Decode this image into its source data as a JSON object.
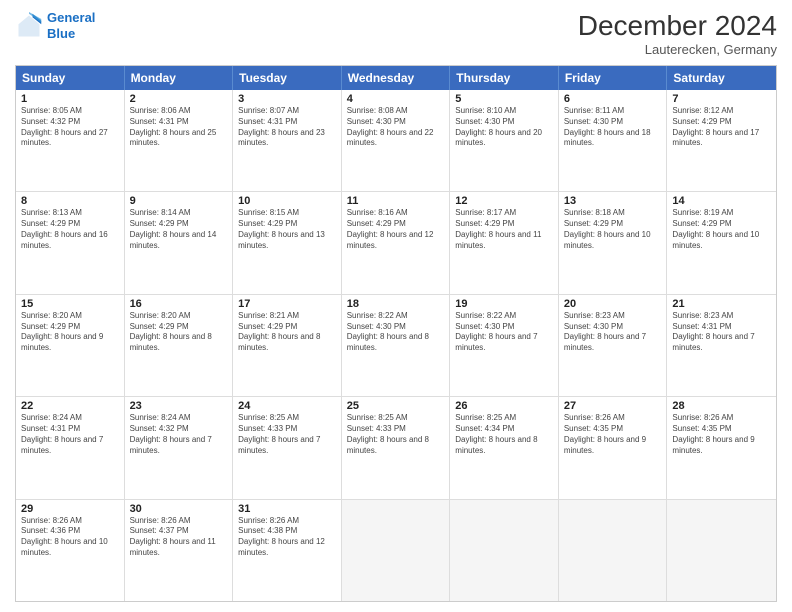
{
  "logo": {
    "line1": "General",
    "line2": "Blue"
  },
  "header": {
    "month_year": "December 2024",
    "location": "Lauterecken, Germany"
  },
  "weekdays": [
    "Sunday",
    "Monday",
    "Tuesday",
    "Wednesday",
    "Thursday",
    "Friday",
    "Saturday"
  ],
  "rows": [
    [
      {
        "day": "1",
        "sunrise": "Sunrise: 8:05 AM",
        "sunset": "Sunset: 4:32 PM",
        "daylight": "Daylight: 8 hours and 27 minutes."
      },
      {
        "day": "2",
        "sunrise": "Sunrise: 8:06 AM",
        "sunset": "Sunset: 4:31 PM",
        "daylight": "Daylight: 8 hours and 25 minutes."
      },
      {
        "day": "3",
        "sunrise": "Sunrise: 8:07 AM",
        "sunset": "Sunset: 4:31 PM",
        "daylight": "Daylight: 8 hours and 23 minutes."
      },
      {
        "day": "4",
        "sunrise": "Sunrise: 8:08 AM",
        "sunset": "Sunset: 4:30 PM",
        "daylight": "Daylight: 8 hours and 22 minutes."
      },
      {
        "day": "5",
        "sunrise": "Sunrise: 8:10 AM",
        "sunset": "Sunset: 4:30 PM",
        "daylight": "Daylight: 8 hours and 20 minutes."
      },
      {
        "day": "6",
        "sunrise": "Sunrise: 8:11 AM",
        "sunset": "Sunset: 4:30 PM",
        "daylight": "Daylight: 8 hours and 18 minutes."
      },
      {
        "day": "7",
        "sunrise": "Sunrise: 8:12 AM",
        "sunset": "Sunset: 4:29 PM",
        "daylight": "Daylight: 8 hours and 17 minutes."
      }
    ],
    [
      {
        "day": "8",
        "sunrise": "Sunrise: 8:13 AM",
        "sunset": "Sunset: 4:29 PM",
        "daylight": "Daylight: 8 hours and 16 minutes."
      },
      {
        "day": "9",
        "sunrise": "Sunrise: 8:14 AM",
        "sunset": "Sunset: 4:29 PM",
        "daylight": "Daylight: 8 hours and 14 minutes."
      },
      {
        "day": "10",
        "sunrise": "Sunrise: 8:15 AM",
        "sunset": "Sunset: 4:29 PM",
        "daylight": "Daylight: 8 hours and 13 minutes."
      },
      {
        "day": "11",
        "sunrise": "Sunrise: 8:16 AM",
        "sunset": "Sunset: 4:29 PM",
        "daylight": "Daylight: 8 hours and 12 minutes."
      },
      {
        "day": "12",
        "sunrise": "Sunrise: 8:17 AM",
        "sunset": "Sunset: 4:29 PM",
        "daylight": "Daylight: 8 hours and 11 minutes."
      },
      {
        "day": "13",
        "sunrise": "Sunrise: 8:18 AM",
        "sunset": "Sunset: 4:29 PM",
        "daylight": "Daylight: 8 hours and 10 minutes."
      },
      {
        "day": "14",
        "sunrise": "Sunrise: 8:19 AM",
        "sunset": "Sunset: 4:29 PM",
        "daylight": "Daylight: 8 hours and 10 minutes."
      }
    ],
    [
      {
        "day": "15",
        "sunrise": "Sunrise: 8:20 AM",
        "sunset": "Sunset: 4:29 PM",
        "daylight": "Daylight: 8 hours and 9 minutes."
      },
      {
        "day": "16",
        "sunrise": "Sunrise: 8:20 AM",
        "sunset": "Sunset: 4:29 PM",
        "daylight": "Daylight: 8 hours and 8 minutes."
      },
      {
        "day": "17",
        "sunrise": "Sunrise: 8:21 AM",
        "sunset": "Sunset: 4:29 PM",
        "daylight": "Daylight: 8 hours and 8 minutes."
      },
      {
        "day": "18",
        "sunrise": "Sunrise: 8:22 AM",
        "sunset": "Sunset: 4:30 PM",
        "daylight": "Daylight: 8 hours and 8 minutes."
      },
      {
        "day": "19",
        "sunrise": "Sunrise: 8:22 AM",
        "sunset": "Sunset: 4:30 PM",
        "daylight": "Daylight: 8 hours and 7 minutes."
      },
      {
        "day": "20",
        "sunrise": "Sunrise: 8:23 AM",
        "sunset": "Sunset: 4:30 PM",
        "daylight": "Daylight: 8 hours and 7 minutes."
      },
      {
        "day": "21",
        "sunrise": "Sunrise: 8:23 AM",
        "sunset": "Sunset: 4:31 PM",
        "daylight": "Daylight: 8 hours and 7 minutes."
      }
    ],
    [
      {
        "day": "22",
        "sunrise": "Sunrise: 8:24 AM",
        "sunset": "Sunset: 4:31 PM",
        "daylight": "Daylight: 8 hours and 7 minutes."
      },
      {
        "day": "23",
        "sunrise": "Sunrise: 8:24 AM",
        "sunset": "Sunset: 4:32 PM",
        "daylight": "Daylight: 8 hours and 7 minutes."
      },
      {
        "day": "24",
        "sunrise": "Sunrise: 8:25 AM",
        "sunset": "Sunset: 4:33 PM",
        "daylight": "Daylight: 8 hours and 7 minutes."
      },
      {
        "day": "25",
        "sunrise": "Sunrise: 8:25 AM",
        "sunset": "Sunset: 4:33 PM",
        "daylight": "Daylight: 8 hours and 8 minutes."
      },
      {
        "day": "26",
        "sunrise": "Sunrise: 8:25 AM",
        "sunset": "Sunset: 4:34 PM",
        "daylight": "Daylight: 8 hours and 8 minutes."
      },
      {
        "day": "27",
        "sunrise": "Sunrise: 8:26 AM",
        "sunset": "Sunset: 4:35 PM",
        "daylight": "Daylight: 8 hours and 9 minutes."
      },
      {
        "day": "28",
        "sunrise": "Sunrise: 8:26 AM",
        "sunset": "Sunset: 4:35 PM",
        "daylight": "Daylight: 8 hours and 9 minutes."
      }
    ],
    [
      {
        "day": "29",
        "sunrise": "Sunrise: 8:26 AM",
        "sunset": "Sunset: 4:36 PM",
        "daylight": "Daylight: 8 hours and 10 minutes."
      },
      {
        "day": "30",
        "sunrise": "Sunrise: 8:26 AM",
        "sunset": "Sunset: 4:37 PM",
        "daylight": "Daylight: 8 hours and 11 minutes."
      },
      {
        "day": "31",
        "sunrise": "Sunrise: 8:26 AM",
        "sunset": "Sunset: 4:38 PM",
        "daylight": "Daylight: 8 hours and 12 minutes."
      },
      null,
      null,
      null,
      null
    ]
  ]
}
